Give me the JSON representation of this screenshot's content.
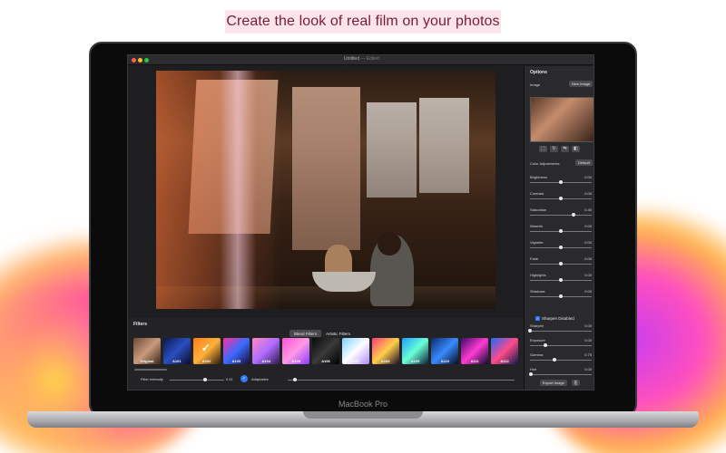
{
  "headline": "Create the look of real film on your photos",
  "device_label": "MacBook Pro",
  "window": {
    "title": "Untitled",
    "separator": " — ",
    "status": "Edited"
  },
  "options": {
    "title": "Options",
    "image_label": "Image",
    "new_image": "New Image",
    "icon_buttons": [
      "crop-icon",
      "rotate-icon",
      "flip-icon",
      "compare-icon"
    ],
    "color_adjustments": "Color Adjustments",
    "default_button": "Default",
    "sliders": [
      {
        "label": "Brightness",
        "value": "0.00",
        "fraction": 0.5
      },
      {
        "label": "Contrast",
        "value": "0.00",
        "fraction": 0.5
      },
      {
        "label": "Saturation",
        "value": "0.40",
        "fraction": 0.7
      },
      {
        "label": "Warmth",
        "value": "0.00",
        "fraction": 0.5
      },
      {
        "label": "Vignette",
        "value": "0.00",
        "fraction": 0.5
      },
      {
        "label": "Fade",
        "value": "0.00",
        "fraction": 0.5
      },
      {
        "label": "Highlights",
        "value": "0.00",
        "fraction": 0.5
      },
      {
        "label": "Shadows",
        "value": "0.00",
        "fraction": 0.5
      }
    ],
    "sharpen_label": "Sharpen Disabled",
    "sliders2": [
      {
        "label": "Sharpen",
        "value": "0.00",
        "fraction": 0.0
      },
      {
        "label": "Exposure",
        "value": "0.00",
        "fraction": 0.25
      },
      {
        "label": "Gamma",
        "value": "0.75",
        "fraction": 0.4
      },
      {
        "label": "Hue",
        "value": "0.00",
        "fraction": 0.02
      }
    ],
    "export_button": "Export Image",
    "share_icon": "share-icon"
  },
  "filters": {
    "title": "Filters",
    "tabs": [
      {
        "label": "Blend Filters",
        "active": true
      },
      {
        "label": "Artistic Filters",
        "active": false
      }
    ],
    "items": [
      {
        "label": "Original",
        "colors": [
          "#6b4a36",
          "#c89b7c",
          "#3a2418"
        ]
      },
      {
        "label": "A101",
        "colors": [
          "#0a1a4a",
          "#2a4fc0",
          "#0a0a2a"
        ]
      },
      {
        "label": "A102",
        "colors": [
          "#ff7a1a",
          "#ffb13a",
          "#2a1a0a"
        ],
        "selected": true
      },
      {
        "label": "A103",
        "colors": [
          "#ff2f9e",
          "#3a6bff",
          "#1a0a3a"
        ]
      },
      {
        "label": "A104",
        "colors": [
          "#ff8ac2",
          "#b06bff",
          "#2a1a4a"
        ]
      },
      {
        "label": "A105",
        "colors": [
          "#ff4fd2",
          "#ff9ae6",
          "#8a3aff"
        ]
      },
      {
        "label": "A106",
        "colors": [
          "#0a0a0a",
          "#3a3a3a",
          "#000000"
        ]
      },
      {
        "label": "A107",
        "colors": [
          "#7ad0ff",
          "#ffffff",
          "#b08aff"
        ]
      },
      {
        "label": "A108",
        "colors": [
          "#ff3a7a",
          "#ffcf4a",
          "#1a0a2a"
        ]
      },
      {
        "label": "A109",
        "colors": [
          "#1aa0ff",
          "#6affd2",
          "#0a1a3a"
        ]
      },
      {
        "label": "A110",
        "colors": [
          "#0a2a6a",
          "#3a8aff",
          "#050a1a"
        ]
      },
      {
        "label": "A111",
        "colors": [
          "#3a0a6a",
          "#ff3ad2",
          "#0a0a2a"
        ]
      },
      {
        "label": "A112",
        "colors": [
          "#1a6aff",
          "#ff4a8a",
          "#0a1a4a"
        ]
      }
    ],
    "intensity_label": "Filter Intensity",
    "intensity_value": "0.41",
    "intensity_fraction": 0.65,
    "adaptative_label": "Adaptative",
    "adaptative_fraction": 0.03
  }
}
